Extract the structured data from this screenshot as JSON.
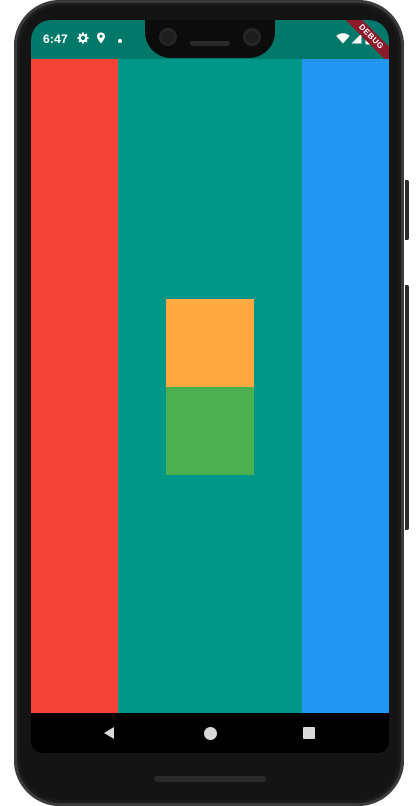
{
  "status_bar": {
    "time": "6:47",
    "background_color": "#00796b",
    "left_icons": [
      "gear-icon",
      "location-pin-icon",
      "dot-icon"
    ],
    "right_icons": [
      "wifi-icon",
      "signal-icon",
      "battery-icon"
    ]
  },
  "debug_banner": {
    "label": "DEBUG"
  },
  "app": {
    "columns": [
      {
        "name": "red",
        "color": "#f44336"
      },
      {
        "name": "teal",
        "color": "#009688"
      },
      {
        "name": "blue",
        "color": "#2196f3"
      }
    ],
    "boxes": [
      {
        "name": "orange",
        "color": "#ffa940"
      },
      {
        "name": "green",
        "color": "#4caf50"
      }
    ]
  },
  "nav_bar": {
    "buttons": [
      "back-icon",
      "home-icon",
      "recents-icon"
    ]
  }
}
